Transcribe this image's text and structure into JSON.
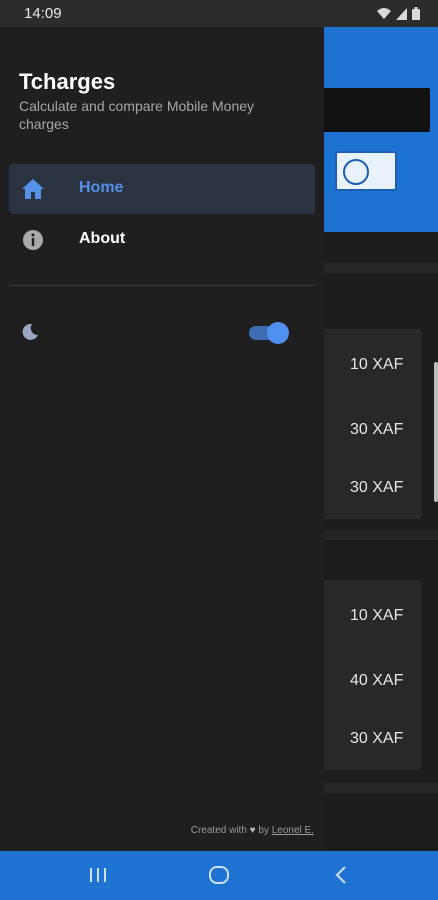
{
  "status_bar": {
    "time": "14:09",
    "icons": [
      "wifi-icon",
      "signal-icon",
      "battery-icon"
    ]
  },
  "drawer": {
    "title": "Tcharges",
    "subtitle": "Calculate and compare Mobile Money charges",
    "items": [
      {
        "label": "Home",
        "icon": "home-icon",
        "active": true
      },
      {
        "label": "About",
        "icon": "info-icon",
        "active": false
      }
    ],
    "theme_toggle": {
      "icon": "moon-icon",
      "on": true
    },
    "footer": {
      "prefix": "Created with",
      "by": "by",
      "author": "Leonel E."
    }
  },
  "background": {
    "fees": [
      "10 XAF",
      "30 XAF",
      "30 XAF",
      "10 XAF",
      "40 XAF",
      "30 XAF"
    ]
  },
  "colors": {
    "accent": "#1e73d2",
    "active_label": "#5591e6",
    "drawer_bg": "#1f1f1f",
    "toggle": "#4f8ff0"
  },
  "bottom_nav": [
    "recents-icon",
    "home-circle-icon",
    "back-icon"
  ]
}
